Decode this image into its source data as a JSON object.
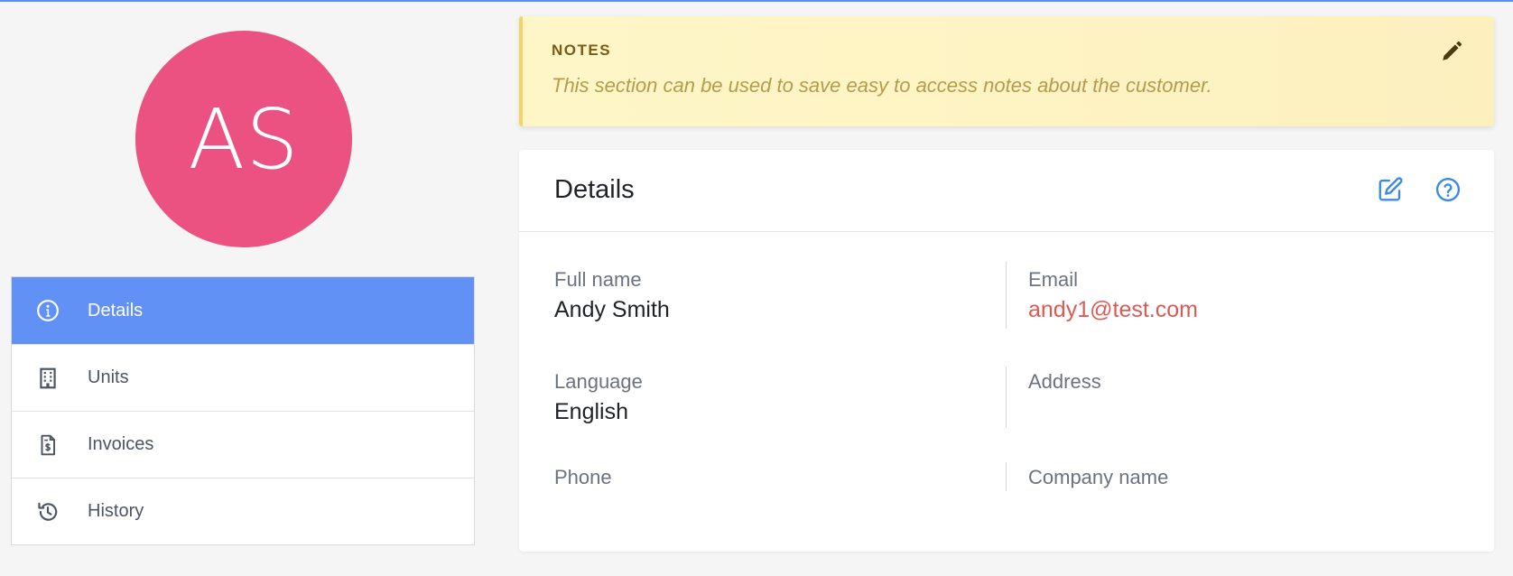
{
  "avatar": {
    "initials": "AS",
    "color": "#ec5281"
  },
  "side_nav": {
    "items": [
      {
        "label": "Details",
        "icon": "info-circle-icon",
        "active": true
      },
      {
        "label": "Units",
        "icon": "building-icon",
        "active": false
      },
      {
        "label": "Invoices",
        "icon": "invoice-dollar-icon",
        "active": false
      },
      {
        "label": "History",
        "icon": "history-icon",
        "active": false
      }
    ],
    "active_color": "#6291f5"
  },
  "notes": {
    "title": "NOTES",
    "placeholder_text": "This section can be used to save easy to access notes about the customer.",
    "edit_icon": "pencil-icon"
  },
  "details": {
    "title": "Details",
    "header_icons": [
      "edit-icon",
      "help-circle-icon"
    ],
    "fields": {
      "full_name": {
        "label": "Full name",
        "value": "Andy Smith"
      },
      "email": {
        "label": "Email",
        "value": "andy1@test.com"
      },
      "language": {
        "label": "Language",
        "value": "English"
      },
      "address": {
        "label": "Address",
        "value": ""
      },
      "phone": {
        "label": "Phone",
        "value": ""
      },
      "company_name": {
        "label": "Company name",
        "value": ""
      }
    }
  },
  "colors": {
    "accent": "#4a90e2",
    "email_link": "#dc5a55",
    "notes_bg": "#fef6c7"
  }
}
